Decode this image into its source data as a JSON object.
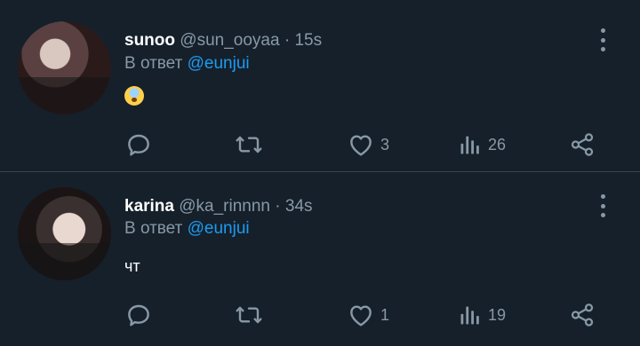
{
  "tweets": [
    {
      "name": "sunoo",
      "handle": "@sun_ooyaa",
      "separator": "·",
      "time": "15s",
      "reply_prefix": "В ответ",
      "reply_to": "@eunjui",
      "text": "😨",
      "likes": "3",
      "views": "26"
    },
    {
      "name": "karina",
      "handle": "@ka_rinnnn",
      "separator": "·",
      "time": "34s",
      "reply_prefix": "В ответ",
      "reply_to": "@eunjui",
      "text": "чт",
      "likes": "1",
      "views": "19"
    }
  ],
  "icons": {
    "reply": "reply-icon",
    "retweet": "retweet-icon",
    "like": "heart-icon",
    "views": "views-icon",
    "share": "share-icon",
    "more": "more-vertical-icon"
  },
  "colors": {
    "background": "#15202b",
    "secondary_text": "#8899a6",
    "accent": "#1d9bf0",
    "divider": "#38444d"
  }
}
